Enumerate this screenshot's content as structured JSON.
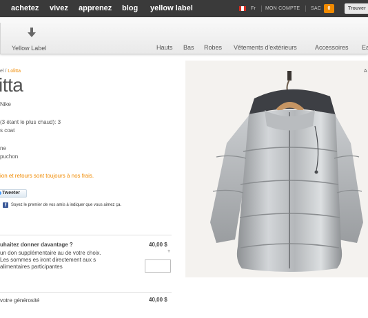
{
  "top_nav": {
    "links": [
      "achetez",
      "vivez",
      "apprenez",
      "blog",
      "yellow label"
    ],
    "language": "Fr",
    "account": "MON COMPTE",
    "bag_label": "SAC",
    "bag_count": "0",
    "search_button": "Trouver"
  },
  "sub_nav": {
    "yellow_label": "Yellow Label",
    "categories": [
      "Hauts",
      "Bas",
      "Robes",
      "Vêtements d'extérieurs",
      "Accessoires",
      "Ea"
    ]
  },
  "product": {
    "breadcrumb_prefix": "el /",
    "breadcrumb_current": "Lolitta",
    "title": "itta",
    "brand": "Nike",
    "warmth": "(3 étant le plus chaud): 3",
    "type": "s coat",
    "feature_1": "ne",
    "feature_2": "puchon",
    "shipping_note": "ion et retours sont toujours à nos frais.",
    "zoom_label": "A"
  },
  "social": {
    "tweet_label": "Tweeter",
    "facebook_text": "Soyez le premier de vos amis à indiquer que vous aimez ça."
  },
  "donation": {
    "title": "uhaitez donner davantage ?",
    "price": "40,00 $",
    "plus": "+",
    "description": "un don supplémentaire au de votre choix. Les sommes es iront directement aux s alimentaires participantes",
    "generosity_label": "votre générosité",
    "generosity_value": "40,00 $"
  },
  "colors": {
    "accent": "#f08a00",
    "top_bar": "#3a3a3a",
    "facebook": "#3b5998"
  }
}
